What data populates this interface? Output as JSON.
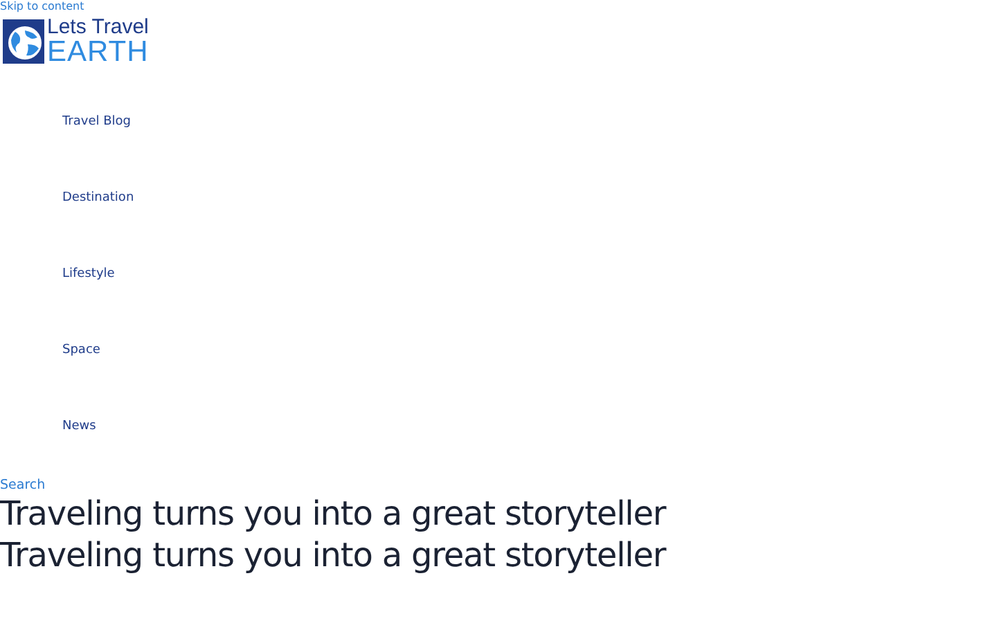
{
  "skip_link": "Skip to content",
  "logo": {
    "line_1": "Lets Travel",
    "line_2": "EARTH"
  },
  "nav": [
    "Travel Blog",
    "Destination",
    "Lifestyle",
    "Space",
    "News"
  ],
  "search": "Search",
  "headings": [
    "Traveling turns you into a great storyteller",
    "Traveling turns you into a great storyteller"
  ]
}
